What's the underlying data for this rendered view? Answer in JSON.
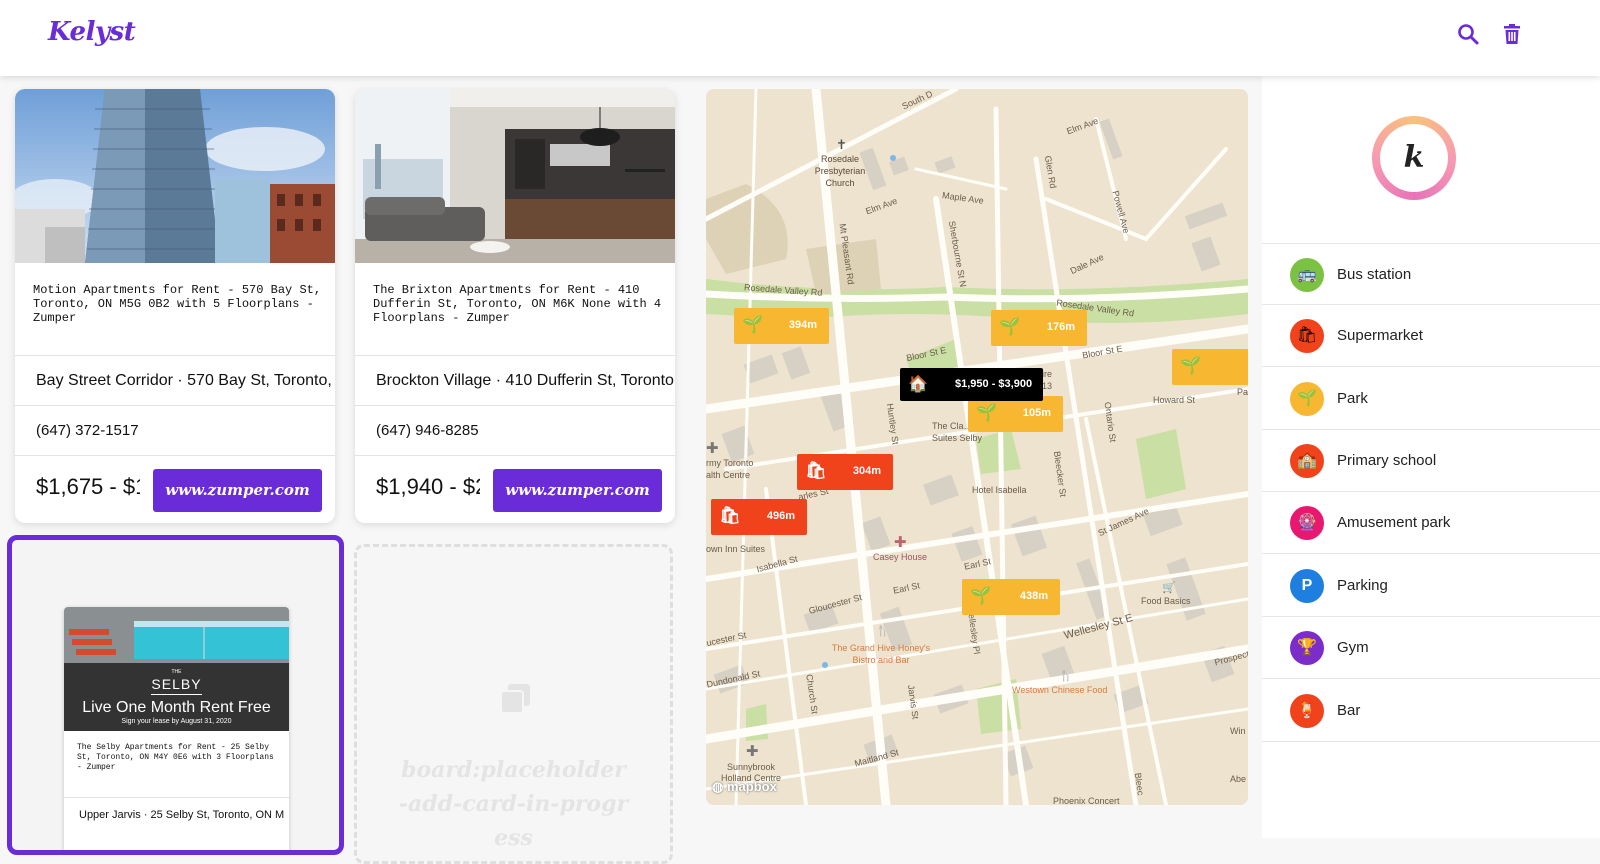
{
  "header": {
    "logo": "Kelyst",
    "search_icon": "search-icon",
    "trash_icon": "trash-icon"
  },
  "board": {
    "cards": [
      {
        "title": "Motion Apartments for Rent - 570 Bay St, Toronto, ON M5G 0B2 with 5 Floorplans - Zumper",
        "address": "Bay Street Corridor · 570 Bay St, Toronto,",
        "phone": "(647) 372-1517",
        "price": "$1,675 - $1",
        "website": "www.zumper.com"
      },
      {
        "title": "The Brixton Apartments for Rent - 410 Dufferin St, Toronto, ON M6K None with 4 Floorplans - Zumper",
        "address": "Brockton Village · 410 Dufferin St, Toronto",
        "phone": "(647) 946-8285",
        "price": "$1,940 - $2",
        "website": "www.zumper.com"
      }
    ],
    "active_card": {
      "brand_the": "THE",
      "brand": "SELBY",
      "promo": "Live One Month Rent Free",
      "promo_sub": "Sign your lease by August 31, 2020",
      "title": "The Selby Apartments for Rent - 25 Selby St, Toronto, ON M4Y 0E6 with 3 Floorplans - Zumper",
      "address": "Upper Jarvis · 25 Selby St, Toronto, ON M"
    },
    "placeholder": "board:placeholder-add-card-in-progress"
  },
  "map": {
    "attribution": "mapbox",
    "listing_price": "$1,950 - $3,900",
    "markers": [
      {
        "label": "394m",
        "kind": "park"
      },
      {
        "label": "176m",
        "kind": "park"
      },
      {
        "label": "105m",
        "kind": "park"
      },
      {
        "label": "304m",
        "kind": "supermarket"
      },
      {
        "label": "496m",
        "kind": "supermarket"
      },
      {
        "label": "438m",
        "kind": "park"
      }
    ],
    "labels": {
      "rosedale_church": "Rosedale Presbyterian Church",
      "elm_ave": "Elm Ave",
      "elm_ave2": "Elm Ave",
      "maple_ave": "Maple Ave",
      "dale_ave": "Dale Ave",
      "powell_ave": "Powell Ave",
      "glen_rd": "Glen Rd",
      "sherbourne": "Sherbourne St N",
      "mt_pleasant": "Mt Pleasant Rd",
      "rosedale_valley": "Rosedale Valley Rd",
      "rosedale_valley2": "Rosedale Valley Rd",
      "bloor": "Bloor St E",
      "bloor2": "Bloor St E",
      "howard": "Howard St",
      "claremont": "The Cla… & Suites Selby",
      "hotel_isabella": "Hotel Isabella",
      "army": "rmy Toronto alth Centre",
      "own_inn": "own Inn Suites",
      "isabella": "Isabella St",
      "casey": "Casey House",
      "earl": "Earl St",
      "earl2": "Earl St",
      "gloucester": "Gloucester St",
      "gloucester2": "ucester St",
      "wellesley": "Wellesley St E",
      "food_basics": "Food Basics",
      "grand_hive": "The Grand Hive Honey's Bistro and Bar",
      "westown": "Westown Chinese Food",
      "dundonald": "Dundonald St",
      "church": "Church St",
      "jarvis": "Jarvis St",
      "maitland": "Maitland St",
      "sunnybrook": "Sunnybrook Holland Centre",
      "phoenix": "Phoenix Concert",
      "huntley": "Huntley St",
      "ontario": "Ontario St",
      "bleecker": "Bleecker St",
      "st_james": "St James Ave",
      "prospect": "Prospect",
      "south_dr": "South D",
      "pa": "Pa",
      "win": "Win",
      "abe": "Abe",
      "bleec2": "Bleec",
      "no13": "13",
      "ire": "ire",
      "arles": "arles St",
      "elles": "ellesley Pl"
    }
  },
  "sidebar": {
    "items": [
      {
        "label": "Bus station",
        "icon": "bus-icon",
        "color": "#7cc242"
      },
      {
        "label": "Supermarket",
        "icon": "shopping-bag-icon",
        "color": "#f0431c"
      },
      {
        "label": "Park",
        "icon": "sprout-icon",
        "color": "#f7b731"
      },
      {
        "label": "Primary school",
        "icon": "school-icon",
        "color": "#f0431c"
      },
      {
        "label": "Amusement park",
        "icon": "ferris-wheel-icon",
        "color": "#e8176f"
      },
      {
        "label": "Parking",
        "icon": "parking-icon",
        "color": "#1f7fe0"
      },
      {
        "label": "Gym",
        "icon": "trophy-icon",
        "color": "#7b2cc9"
      },
      {
        "label": "Bar",
        "icon": "cocktail-icon",
        "color": "#f0431c"
      }
    ]
  },
  "colors": {
    "brand": "#6a2cd8",
    "park": "#f7b731",
    "supermarket": "#f0431c"
  }
}
